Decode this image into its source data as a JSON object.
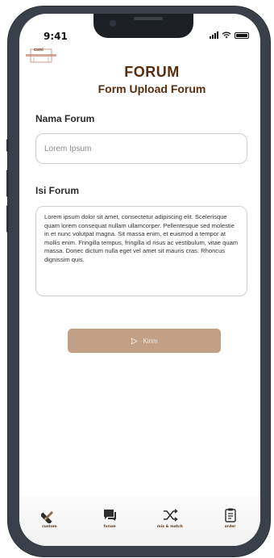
{
  "status_bar": {
    "time": "9:41"
  },
  "logo": {
    "text": "cuni"
  },
  "header": {
    "title": "FORUM",
    "subtitle": "Form Upload Forum"
  },
  "form": {
    "nama_label": "Nama Forum",
    "nama_placeholder": "Lorem Ipsum",
    "isi_label": "Isi Forum",
    "isi_value": "Lorem ipsum dolor sit amet, consectetur adipiscing elit. Scelerisque quam lorem consequat nullam ullamcorper. Pellentesque sed molestie in et nunc volutpat magna. Sit massa enim, et euismod a tempor at mollis enim. Fringilla tempus, fringilla id risus ac vestibulum, vitae quam massa. Donec dictum nulla eget vel amet sit mauris cras. Rhoncus dignissim quis.",
    "submit_label": "Kirim"
  },
  "nav": {
    "items": [
      {
        "label": "custom",
        "icon": "pencil-ruler-icon"
      },
      {
        "label": "forum",
        "icon": "chat-icon"
      },
      {
        "label": "mix & match",
        "icon": "shuffle-icon"
      },
      {
        "label": "order",
        "icon": "clipboard-icon"
      }
    ]
  },
  "colors": {
    "brand": "#5a2e0c",
    "button": "#c2a086"
  }
}
